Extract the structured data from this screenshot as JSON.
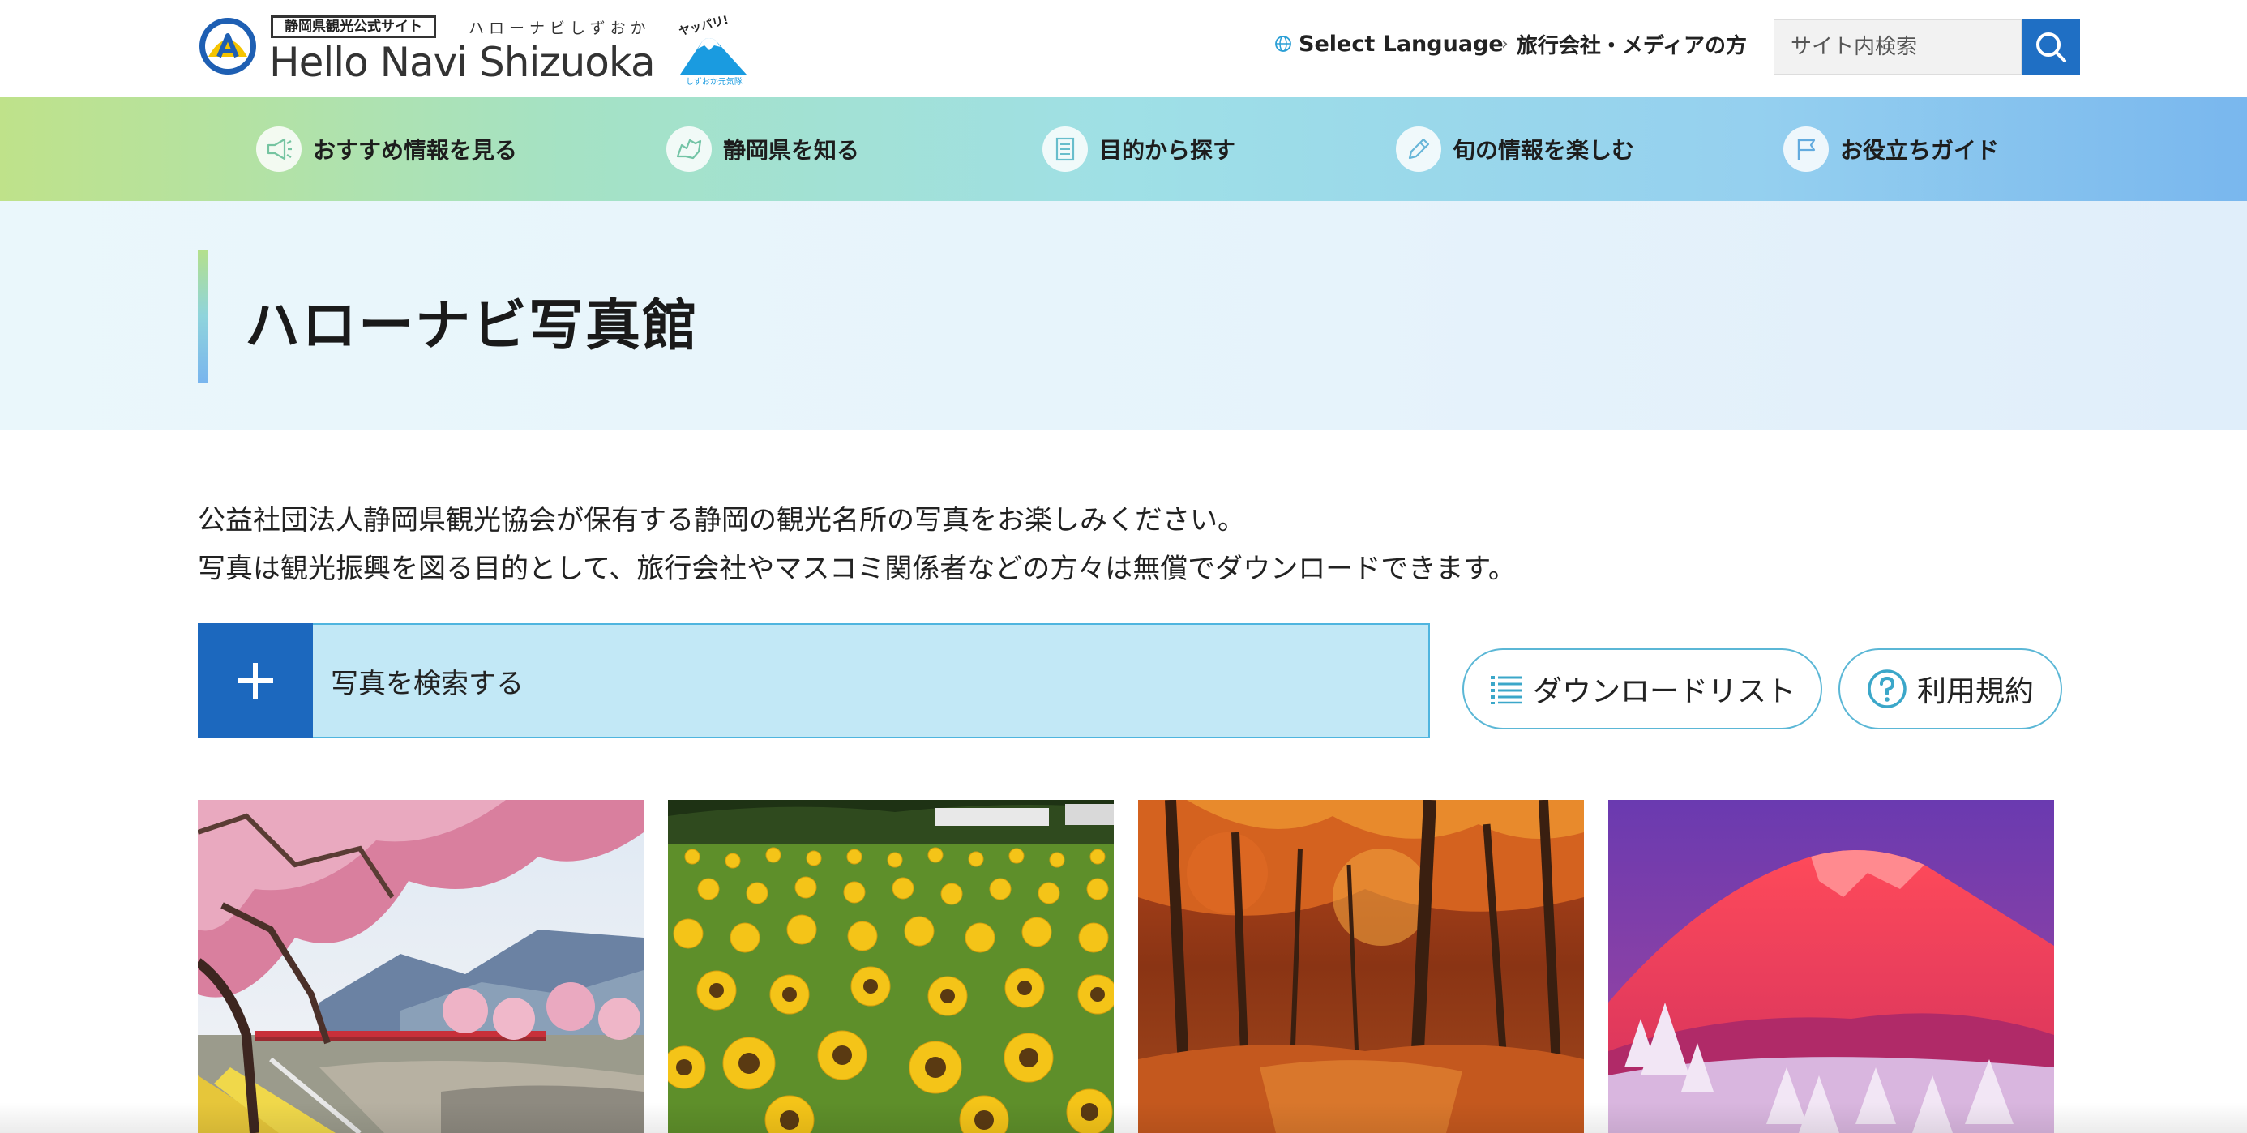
{
  "header": {
    "logo": {
      "badge": "静岡県観光公式サイト",
      "kana": "ハローナビしずおか",
      "name": "Hello Navi Shizuoka",
      "mascot_caption": "しずおか元気隊",
      "mascot_text": "ヤッパリ!"
    },
    "language_label": "Select Language",
    "agency_label": "旅行会社・メディアの方",
    "search": {
      "placeholder": "サイト内検索",
      "button_icon": "search-icon"
    }
  },
  "nav": {
    "items": [
      {
        "label": "おすすめ情報を見る",
        "icon": "megaphone-icon"
      },
      {
        "label": "静岡県を知る",
        "icon": "map-icon"
      },
      {
        "label": "目的から探す",
        "icon": "document-icon"
      },
      {
        "label": "旬の情報を楽しむ",
        "icon": "pencil-icon"
      },
      {
        "label": "お役立ちガイド",
        "icon": "flag-icon"
      }
    ]
  },
  "page": {
    "title": "ハローナビ写真館",
    "intro": [
      "公益社団法人静岡県観光協会が保有する静岡の観光名所の写真をお楽しみください。",
      "写真は観光振興を図る目的として、旅行会社やマスコミ関係者などの方々は無償でダウンロードできます。"
    ]
  },
  "search_panel": {
    "label": "写真を検索する",
    "icon": "plus-icon"
  },
  "buttons": {
    "download_list": {
      "label": "ダウンロードリスト",
      "icon": "list-icon"
    },
    "terms": {
      "label": "利用規約",
      "icon": "question-icon"
    }
  },
  "colors": {
    "accent_blue": "#1c68be",
    "search_panel_bg": "#c2e8f6",
    "pill_border": "#5bb7d6",
    "nav_gradient_start": "#bfe28a",
    "nav_gradient_end": "#79b7ee"
  },
  "photos": [
    {
      "subject": "cherry-blossom-river"
    },
    {
      "subject": "sunflower-field"
    },
    {
      "subject": "autumn-forest"
    },
    {
      "subject": "red-mount-fuji-snow"
    }
  ]
}
